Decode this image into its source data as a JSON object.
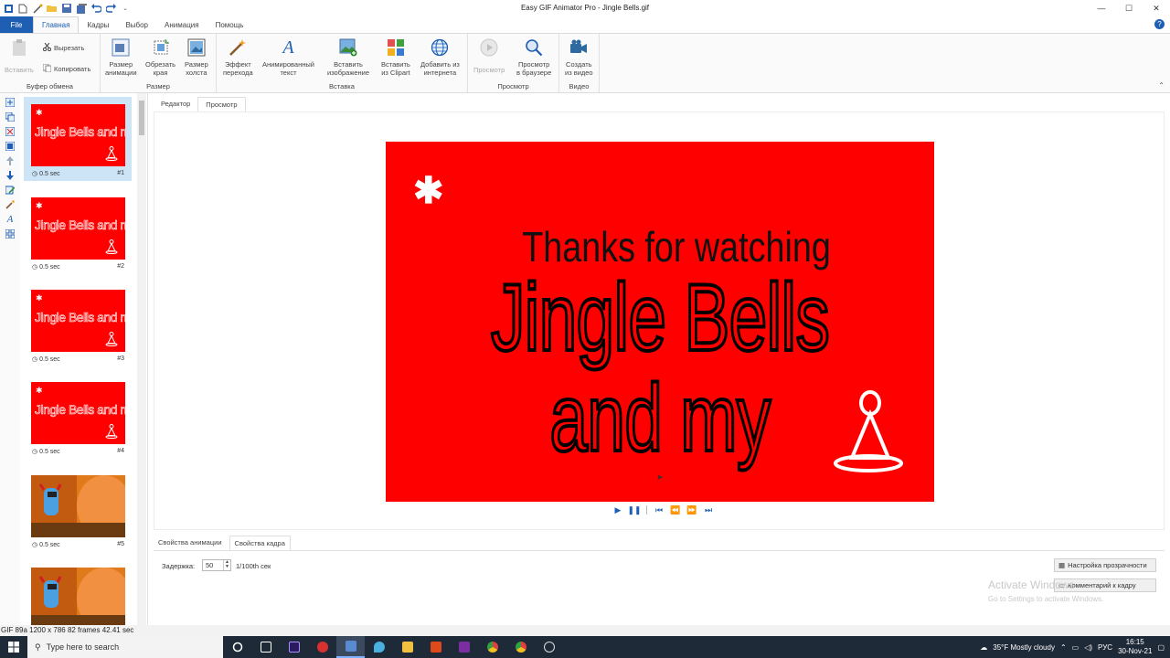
{
  "app": {
    "title": "Easy GIF Animator Pro - Jingle Bells.gif"
  },
  "window_controls": {
    "minimize": "—",
    "maximize": "☐",
    "close": "✕"
  },
  "ribbon_tabs": [
    {
      "label": "File"
    },
    {
      "label": "Главная"
    },
    {
      "label": "Кадры"
    },
    {
      "label": "Выбор"
    },
    {
      "label": "Анимация"
    },
    {
      "label": "Помощь"
    }
  ],
  "ribbon": {
    "clipboard": {
      "paste": "Вставить",
      "cut": "Вырезать",
      "copy": "Копировать",
      "group": "Буфер обмена"
    },
    "size": {
      "resize_anim": [
        "Размер",
        "анимации"
      ],
      "crop": [
        "Обрезать",
        "края"
      ],
      "canvas": [
        "Размер",
        "холста"
      ],
      "group": "Размер"
    },
    "insert": {
      "transition": [
        "Эффект",
        "перехода"
      ],
      "animated_text": [
        "Анимированный",
        "текст"
      ],
      "insert_image": [
        "Вставить",
        "изображение"
      ],
      "clipart": [
        "Вставить",
        "из Clipart"
      ],
      "internet": [
        "Добавить из",
        "интернета"
      ],
      "group": "Вставка"
    },
    "preview": {
      "preview": "Просмотр",
      "browser": [
        "Просмотр",
        "в браузере"
      ],
      "group": "Просмотр"
    },
    "video": {
      "create": [
        "Создать",
        "из видео"
      ],
      "group": "Видео"
    }
  },
  "frames": [
    {
      "delay": "0.5 sec",
      "num": "#1",
      "thumb": "red"
    },
    {
      "delay": "0.5 sec",
      "num": "#2",
      "thumb": "red"
    },
    {
      "delay": "0.5 sec",
      "num": "#3",
      "thumb": "red"
    },
    {
      "delay": "0.5 sec",
      "num": "#4",
      "thumb": "red"
    },
    {
      "delay": "0.5 sec",
      "num": "#5",
      "thumb": "cartoon"
    },
    {
      "delay": "",
      "num": "",
      "thumb": "cartoon"
    }
  ],
  "frame_thumb_text": "Jingle Bells and my",
  "editor_tabs": {
    "editor": "Редактор",
    "preview": "Просмотр"
  },
  "preview": {
    "line1": "Thanks for watching",
    "line2": "Jingle Bells and my"
  },
  "props": {
    "tab_anim": "Свойства анимации",
    "tab_frame": "Свойства кадра",
    "delay_label": "Задержка:",
    "delay_value": "50",
    "delay_unit": "1/100th сек",
    "transparency_btn": "Настройка прозрачности",
    "comment_btn": "Комментарий к кадру",
    "watermark1": "Activate Windows",
    "watermark2": "Go to Settings to activate Windows."
  },
  "status": "GIF 89a 1200 x 786 82 frames 42.41 sec",
  "taskbar": {
    "search_placeholder": "Type here to search",
    "weather": "35°F  Mostly cloudy",
    "lang": "РУС",
    "time": "16:15",
    "date": "30-Nov-21"
  },
  "colors": {
    "accent": "#1e5fb4",
    "preview_bg": "#ff0000",
    "selected_frame": "#cde4f7",
    "taskbar": "#1f2a38"
  }
}
